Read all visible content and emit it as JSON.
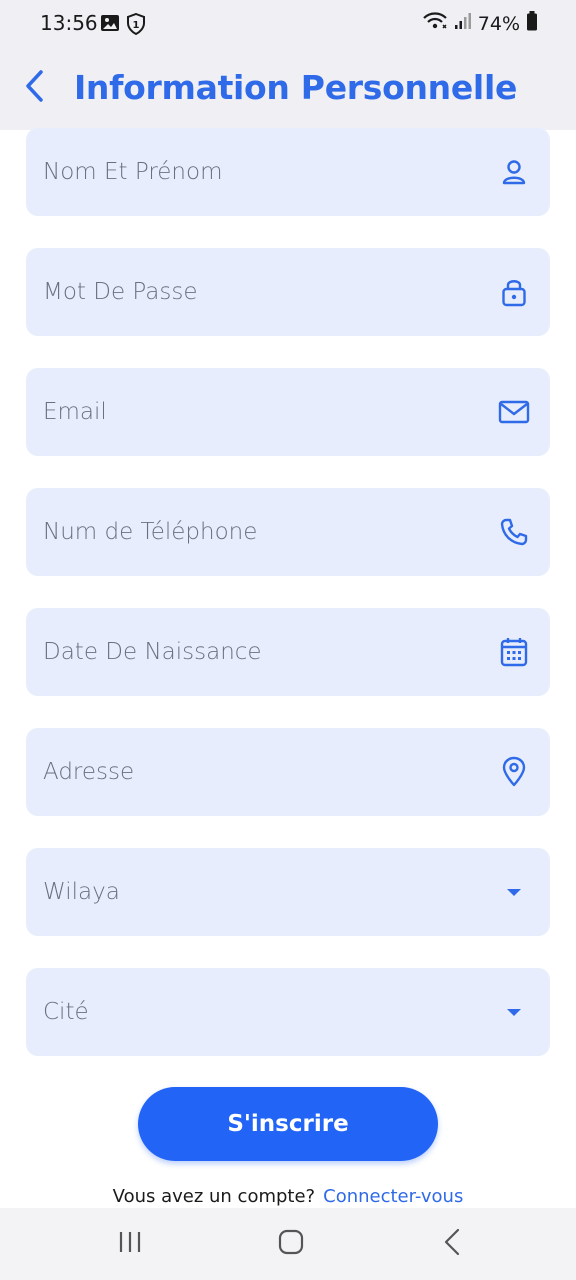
{
  "status_bar": {
    "time": "13:56",
    "battery_percent": "74%",
    "icons_left": [
      "image-icon",
      "shield-icon"
    ],
    "icons_right": [
      "wifi-icon",
      "signal-icon",
      "battery-icon"
    ]
  },
  "header": {
    "title": "Information Personnelle",
    "back_icon": "chevron-left-icon"
  },
  "form": {
    "fields": [
      {
        "placeholder": "Nom Et Prénom",
        "icon": "person-icon"
      },
      {
        "placeholder": "Mot De Passe",
        "icon": "lock-icon"
      },
      {
        "placeholder": "Email",
        "icon": "mail-icon"
      },
      {
        "placeholder": "Num de Téléphone",
        "icon": "phone-icon"
      },
      {
        "placeholder": "Date De Naissance",
        "icon": "calendar-icon"
      },
      {
        "placeholder": "Adresse",
        "icon": "location-pin-icon"
      },
      {
        "placeholder": "Wilaya",
        "icon": "dropdown-arrow-icon"
      },
      {
        "placeholder": "Cité",
        "icon": "dropdown-arrow-icon"
      }
    ]
  },
  "actions": {
    "submit_label": "S'inscrire",
    "login_prompt": "Vous avez un compte?",
    "login_link": "Connecter-vous"
  },
  "colors": {
    "accent": "#2f6ae8",
    "button": "#2264f5",
    "field_bg": "#e7edfd",
    "placeholder_text": "#6b6f80"
  }
}
